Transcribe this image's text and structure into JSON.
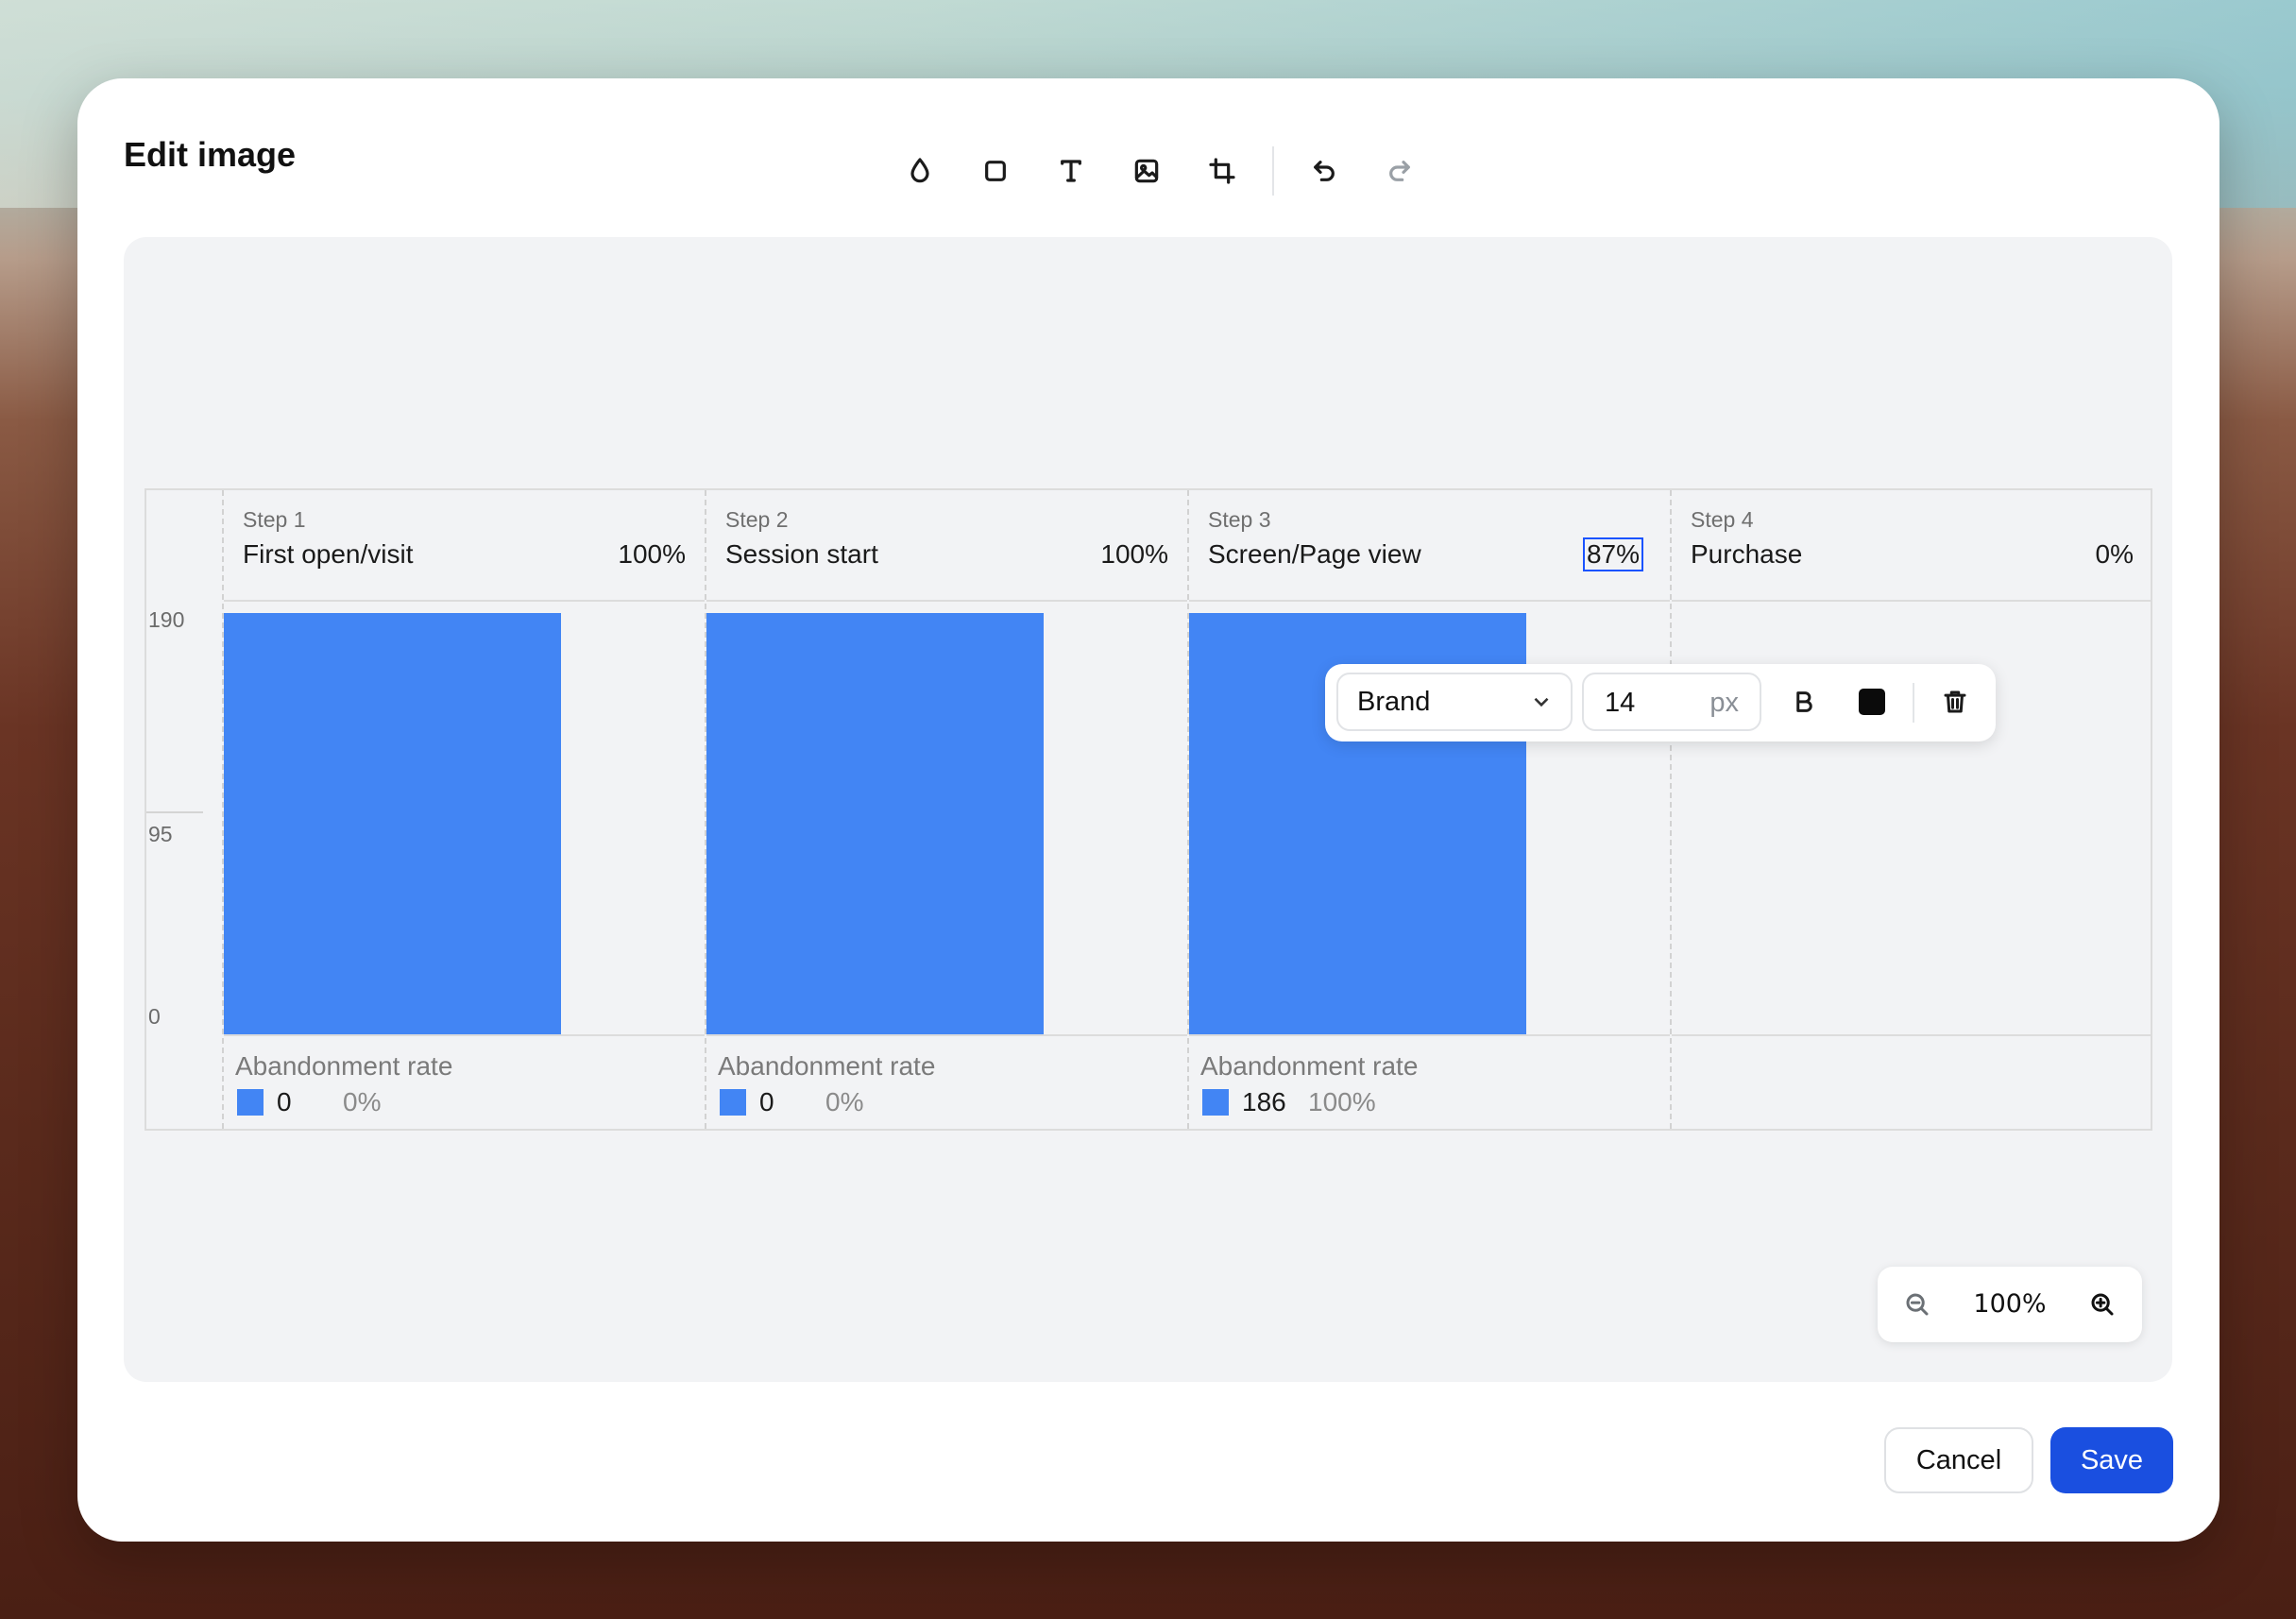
{
  "dialog": {
    "title": "Edit image",
    "cancel_label": "Cancel",
    "save_label": "Save"
  },
  "toolbar": {
    "tools": [
      {
        "name": "blur",
        "icon": "droplet-icon"
      },
      {
        "name": "shape",
        "icon": "square-icon"
      },
      {
        "name": "text",
        "icon": "text-icon"
      },
      {
        "name": "image",
        "icon": "image-icon"
      },
      {
        "name": "crop",
        "icon": "crop-icon"
      },
      {
        "name": "undo",
        "icon": "undo-icon"
      },
      {
        "name": "redo",
        "icon": "redo-icon",
        "disabled": true
      }
    ]
  },
  "funnel": {
    "y_ticks": [
      "190",
      "95",
      "0"
    ],
    "y_max": 190,
    "bar_color": "#4285f4",
    "steps": [
      {
        "step": "Step 1",
        "name": "First open/visit",
        "pct": "100%",
        "value": 190,
        "ab_label": "Abandonment rate",
        "ab_count": "0",
        "ab_pct": "0%"
      },
      {
        "step": "Step 2",
        "name": "Session start",
        "pct": "100%",
        "value": 190,
        "ab_label": "Abandonment rate",
        "ab_count": "0",
        "ab_pct": "0%"
      },
      {
        "step": "Step 3",
        "name": "Screen/Page view",
        "pct": "87%",
        "value": 190,
        "ab_label": "Abandonment rate",
        "ab_count": "186",
        "ab_pct": "100%"
      },
      {
        "step": "Step 4",
        "name": "Purchase",
        "pct": "0%",
        "value": 0
      }
    ]
  },
  "text_toolbar": {
    "font": "Brand",
    "size": "14",
    "unit": "px",
    "bold_icon": "bold-icon",
    "color": "#0b0b0b",
    "delete_icon": "trash-icon"
  },
  "zoom": {
    "value": "100%",
    "zoom_out_icon": "zoom-out-icon",
    "zoom_in_icon": "zoom-in-icon"
  }
}
